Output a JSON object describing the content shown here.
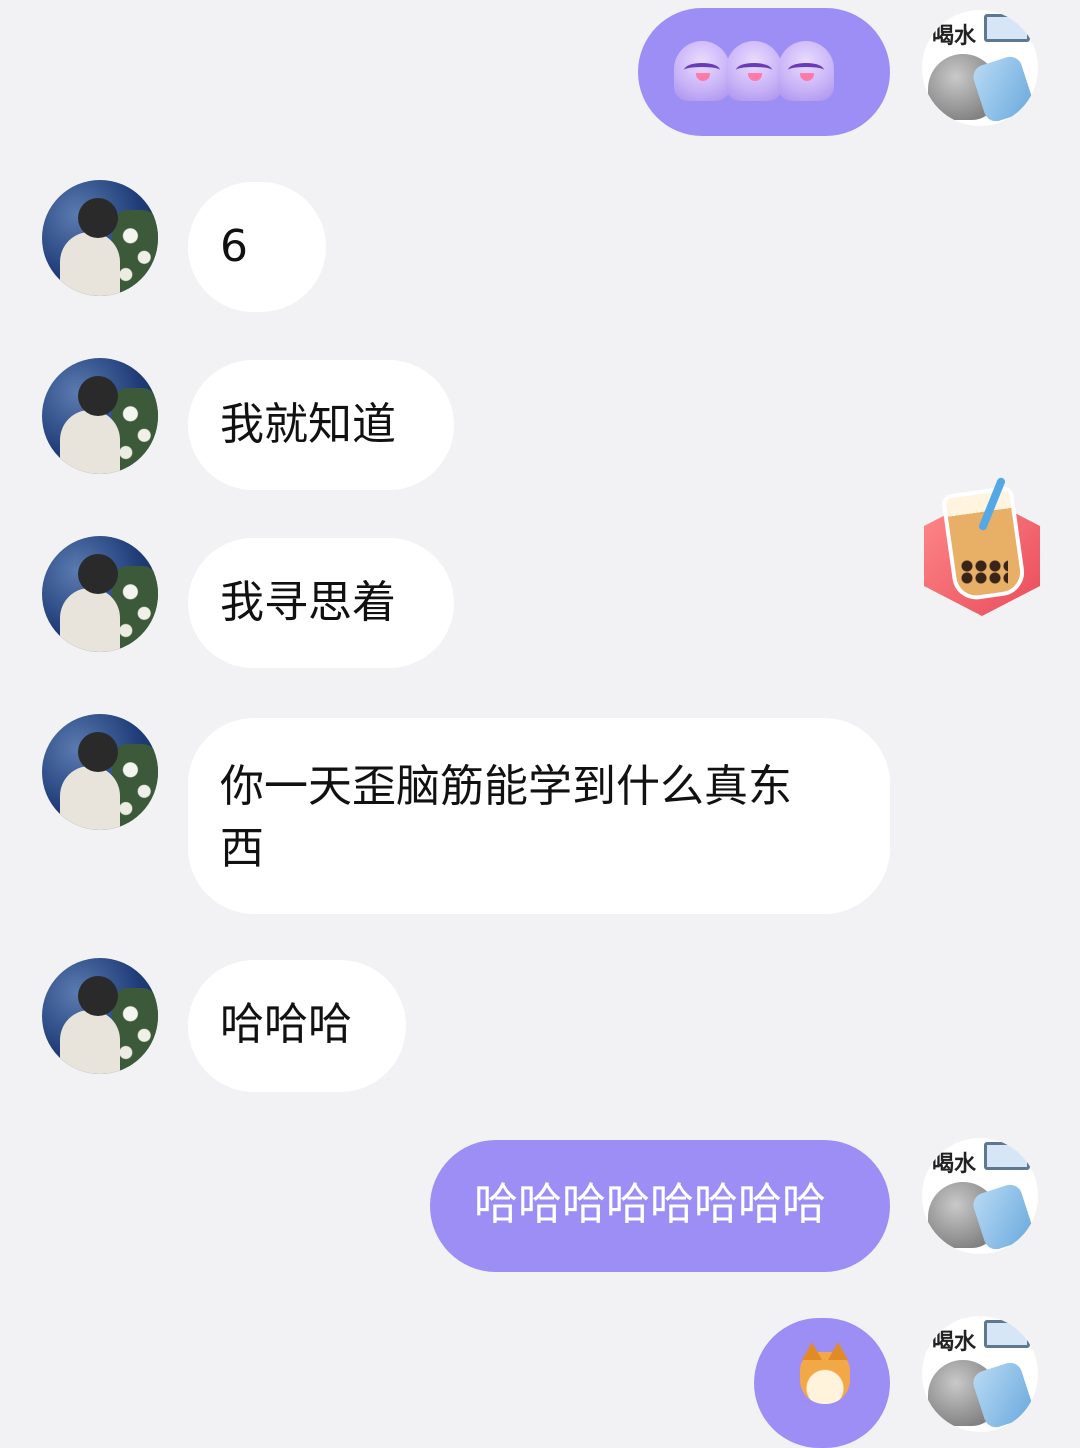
{
  "messages": [
    {
      "sender": "self",
      "type": "emoji",
      "emoji": "ghost-laugh-emoji",
      "count": 3
    },
    {
      "sender": "other",
      "type": "text",
      "text": "6"
    },
    {
      "sender": "other",
      "type": "text",
      "text": "我就知道"
    },
    {
      "sender": "self",
      "type": "sticker",
      "sticker": "bubble-tea-sticker"
    },
    {
      "sender": "other",
      "type": "text",
      "text": "我寻思着"
    },
    {
      "sender": "other",
      "type": "text",
      "text": "你一天歪脑筋能学到什么真东西"
    },
    {
      "sender": "other",
      "type": "text",
      "text": "哈哈哈"
    },
    {
      "sender": "self",
      "type": "text",
      "text": "哈哈哈哈哈哈哈哈"
    },
    {
      "sender": "self",
      "type": "emoji",
      "emoji": "shiba-dog-emoji",
      "count": 1
    }
  ],
  "self_avatar": {
    "caption": "喝水",
    "icon": "monkey-drinking-water-avatar"
  },
  "other_avatar": {
    "icon": "person-with-flowers-avatar"
  },
  "colors": {
    "background": "#f2f2f4",
    "self_bubble": "#9d8ef6",
    "other_bubble": "#ffffff"
  }
}
